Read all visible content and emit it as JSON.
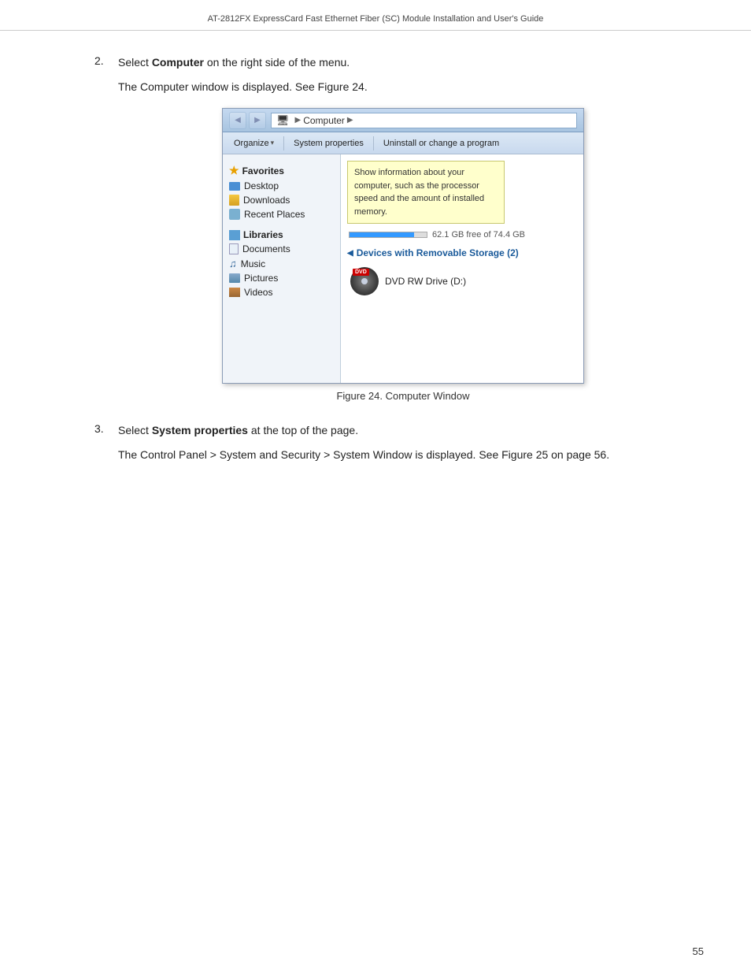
{
  "header": {
    "title": "AT-2812FX ExpressCard Fast Ethernet Fiber (SC) Module Installation and User's Guide"
  },
  "page_number": "55",
  "steps": [
    {
      "number": "2.",
      "text": "Select ",
      "bold": "Computer",
      "text_after": " on the right side of the menu.",
      "sub_text": "The Computer window is displayed. See Figure 24."
    },
    {
      "number": "3.",
      "text": "Select ",
      "bold": "System properties",
      "text_after": " at the top of the page.",
      "sub_text": "The Control Panel > System and Security > System Window is displayed. See Figure 25 on page 56."
    }
  ],
  "figure": {
    "caption": "Figure 24. Computer Window"
  },
  "explorer": {
    "address": "Computer",
    "address_arrow": "▶",
    "toolbar": {
      "organize": "Organize",
      "system_properties": "System properties",
      "uninstall": "Uninstall or change a program"
    },
    "sidebar": {
      "favorites_label": "Favorites",
      "desktop_label": "Desktop",
      "downloads_label": "Downloads",
      "recent_label": "Recent Places",
      "libraries_label": "Libraries",
      "documents_label": "Documents",
      "music_label": "Music",
      "pictures_label": "Pictures",
      "videos_label": "Videos"
    },
    "main": {
      "tooltip_text": "Show information about your computer, such as the processor speed and the amount of installed memory.",
      "disk_info": "62.1 GB free of 74.4 GB",
      "section_header": "Devices with Removable Storage (2)",
      "dvd_label": "DVD",
      "dvd_drive": "DVD RW Drive (D:)"
    }
  }
}
